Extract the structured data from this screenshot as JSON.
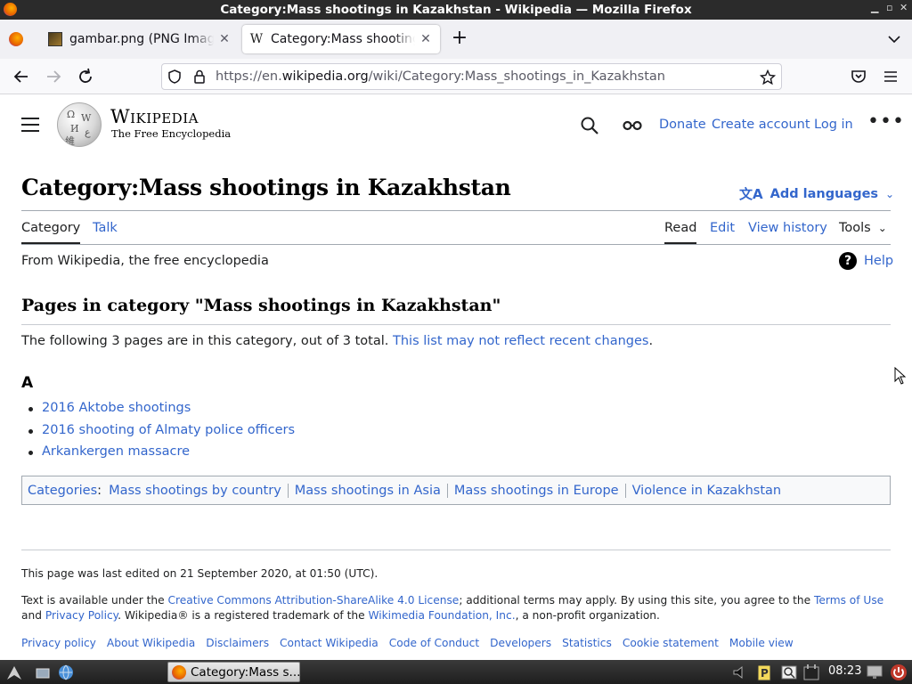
{
  "window": {
    "title": "Category:Mass shootings in Kazakhstan - Wikipedia — Mozilla Firefox"
  },
  "tabs": [
    {
      "label": "gambar.png (PNG Image",
      "active": false
    },
    {
      "label": "Category:Mass shootings in Kazakhstan",
      "active": true
    }
  ],
  "urlbar": {
    "prefix": "https://en.",
    "domain": "wikipedia.org",
    "path": "/wiki/Category:Mass_shootings_in_Kazakhstan"
  },
  "header": {
    "wordmark": "Wikipedia",
    "tagline": "The Free Encyclopedia",
    "donate": "Donate",
    "create_account": "Create account",
    "login": "Log in",
    "more": "•••"
  },
  "page": {
    "title": "Category:Mass shootings in Kazakhstan",
    "add_languages": "Add languages",
    "tabs_left": [
      "Category",
      "Talk"
    ],
    "tabs_right": [
      "Read",
      "Edit",
      "View history",
      "Tools"
    ],
    "from": "From Wikipedia, the free encyclopedia",
    "help": "Help",
    "heading": "Pages in category \"Mass shootings in Kazakhstan\"",
    "summary_text": "The following 3 pages are in this category, out of 3 total. ",
    "summary_link": "This list may not reflect recent changes",
    "summary_end": ".",
    "letter": "A",
    "pages": [
      "2016 Aktobe shootings",
      "2016 shooting of Almaty police officers",
      "Arkankergen massacre"
    ],
    "categories_label": "Categories",
    "categories_colon": ":",
    "categories": [
      "Mass shootings by country",
      "Mass shootings in Asia",
      "Mass shootings in Europe",
      "Violence in Kazakhstan"
    ]
  },
  "footer": {
    "last_edited": "This page was last edited on 21 September 2020, at 01:50 (UTC).",
    "license_1": "Text is available under the ",
    "license_link": "Creative Commons Attribution-ShareAlike 4.0 License",
    "license_2": "; additional terms may apply. By using this site, you agree to the ",
    "terms_link": "Terms of Use",
    "license_3": " and ",
    "privacy_link": "Privacy Policy",
    "license_4": ". Wikipedia® is a registered trademark of the ",
    "wmf_link": "Wikimedia Foundation, Inc.",
    "license_5": ", a non-profit organization.",
    "links": [
      "Privacy policy",
      "About Wikipedia",
      "Disclaimers",
      "Contact Wikipedia",
      "Code of Conduct",
      "Developers",
      "Statistics",
      "Cookie statement",
      "Mobile view"
    ]
  },
  "taskbar": {
    "task_label": "Category:Mass s...",
    "clock": "08:23"
  },
  "colors": {
    "link": "#3366cc",
    "text": "#202122",
    "border": "#a2a9b1"
  }
}
